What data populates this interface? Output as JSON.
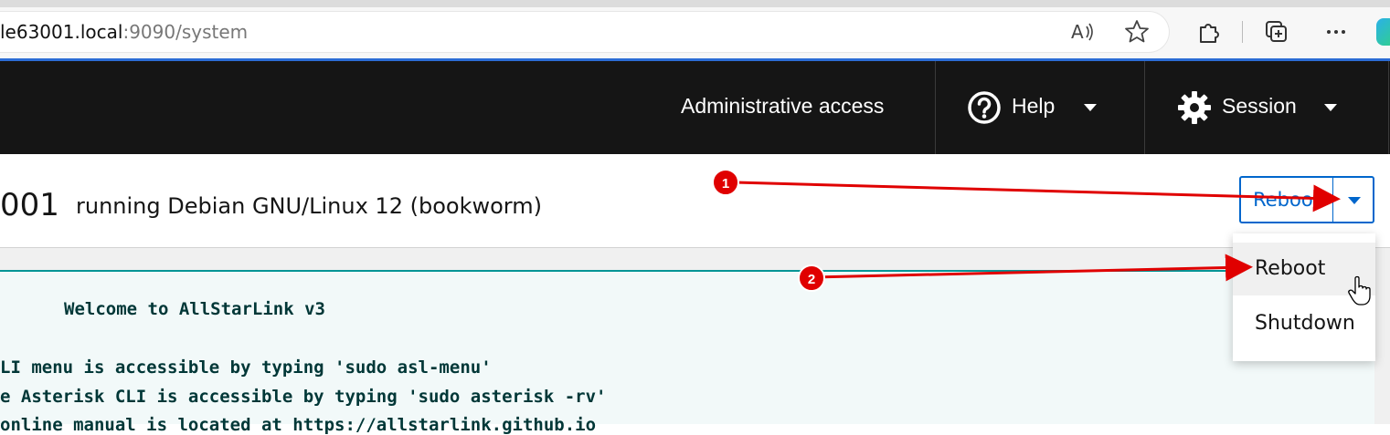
{
  "browser": {
    "url_host": "le63001.local",
    "url_rest": ":9090/system",
    "icons": [
      "read-aloud-icon",
      "favorite-star-icon",
      "extensions-icon",
      "collections-icon",
      "more-icon",
      "copilot-icon"
    ]
  },
  "masthead": {
    "admin_access": "Administrative access",
    "help_label": "Help",
    "session_label": "Session"
  },
  "header": {
    "hostname": "001",
    "os_text": "running Debian GNU/Linux 12 (bookworm)",
    "reboot_button": "Reboot"
  },
  "menu": {
    "items": [
      {
        "label": "Reboot",
        "hovered": true
      },
      {
        "label": "Shutdown",
        "hovered": false
      }
    ]
  },
  "motd": {
    "lines": [
      "Welcome to AllStarLink v3",
      "LI menu is accessible by typing 'sudo asl-menu'",
      "e Asterisk CLI is accessible by typing 'sudo asterisk -rv'",
      "online manual is located at https://allstarlink.github.io"
    ]
  },
  "annotations": {
    "badge1": "1",
    "badge2": "2",
    "color": "#e00000"
  },
  "colors": {
    "masthead_bg": "#151515",
    "accent_blue": "#0066cc",
    "motd_border": "#009596"
  }
}
